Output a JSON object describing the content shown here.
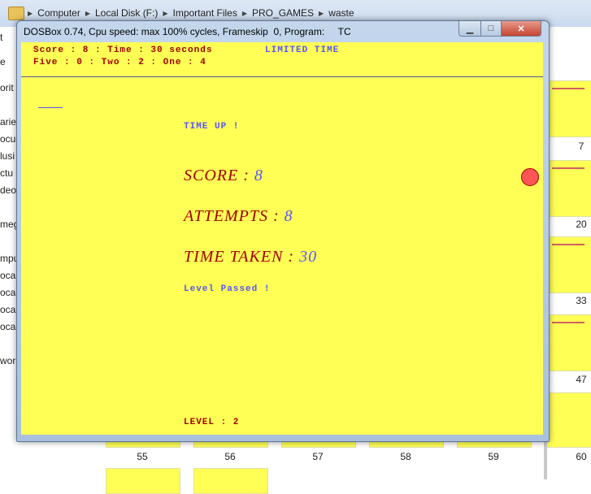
{
  "explorer": {
    "breadcrumb": [
      "Computer",
      "Local Disk (F:)",
      "Important Files",
      "PRO_GAMES",
      "waste"
    ],
    "left_labels": [
      "t",
      "e",
      "orit",
      "arie",
      "ocu",
      "lusi",
      "ctu",
      "deo",
      "meg",
      "mpu",
      "ocal",
      "ocal",
      "ocal",
      "ocal",
      "wor"
    ],
    "thumbnail_labels": [
      "7",
      "20",
      "33",
      "47",
      "55",
      "56",
      "57",
      "58",
      "59",
      "60"
    ]
  },
  "dosbox": {
    "title": "DOSBox 0.74, Cpu speed: max 100% cycles, Frameskip  0, Program:     TC",
    "min_glyph": "▁",
    "max_glyph": "□",
    "close_glyph": "✕",
    "header_line1": "Score : 8 : Time : 30 seconds",
    "header_line2": "Five : 0 : Two : 2 : One : 4",
    "mode": "LIMITED TIME",
    "time_up": "TIME UP !",
    "score_label": "SCORE : ",
    "score_value": "8",
    "attempts_label": "ATTEMPTS : ",
    "attempts_value": "8",
    "time_taken_label": "TIME TAKEN : ",
    "time_taken_value": "30",
    "level_passed": "Level Passed !",
    "level_text": "LEVEL : 2"
  }
}
